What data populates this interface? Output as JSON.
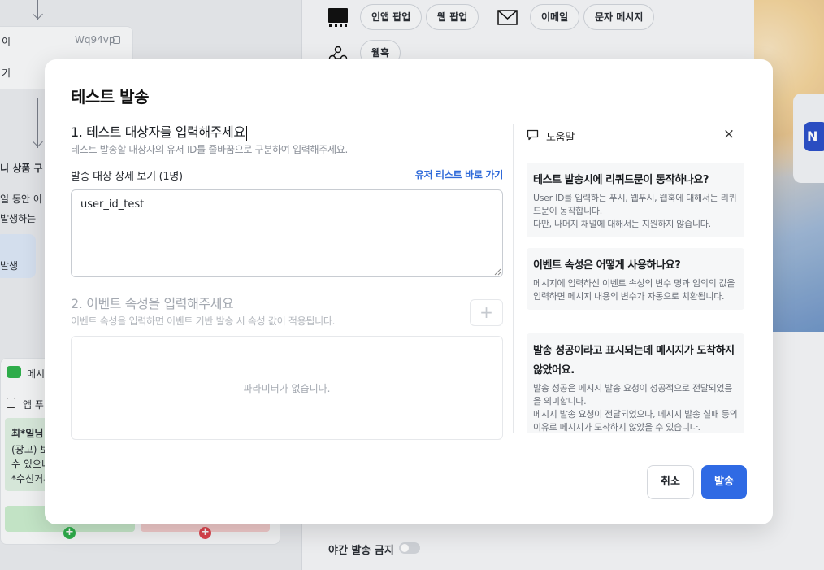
{
  "background": {
    "flow": {
      "node1_label": "이",
      "node1_code": "Wq94vp",
      "node1_sub": "기",
      "product_label": "니 상품 구",
      "period_text": "일 동안 이",
      "occur_text": "발생하는",
      "occur_badge": "발생",
      "message_node_label": "메시",
      "app_push_label": "앱 푸",
      "msg_preview_lines": [
        "최*일님",
        "(광고) 보",
        "수 있으니",
        "*수신거부"
      ]
    },
    "channels": {
      "in_app_popup": "인앱 팝업",
      "web_popup": "웹 팝업",
      "email": "이메일",
      "sms": "문자 메시지",
      "webhook": "웹훅"
    },
    "night_block_label": "야간 발송 금지"
  },
  "modal": {
    "title": "테스트 발송",
    "section1": {
      "title": "1. 테스트 대상자를 입력해주세요",
      "description": "테스트 발송할 대상자의 유저 ID를 줄바꿈으로 구분하여 입력해주세요.",
      "detail_label": "발송 대상 상세 보기 (1명)",
      "user_list_link": "유저 리스트 바로 가기",
      "targets_value": "user_id_test"
    },
    "section2": {
      "title": "2. 이벤트 속성을 입력해주세요",
      "description": "이벤트 속성을 입력하면 이벤트 기반 발송 시 속성 값이 적용됩니다.",
      "add_symbol": "+",
      "empty_text": "파라미터가 없습니다."
    },
    "help": {
      "title": "도움말",
      "close_symbol": "×",
      "items": [
        {
          "question": "테스트 발송시에 리퀴드문이 동작하나요?",
          "answer": "User ID를 입력하는 푸시, 웹푸시, 웹훅에 대해서는 리퀴드문이 동작합니다.\n다만, 나머지 채널에 대해서는 지원하지 않습니다."
        },
        {
          "question": "이벤트 속성은 어떻게 사용하나요?",
          "answer": "메시지에 입력하신 이벤트 속성의 변수 명과 임의의 값을 입력하면 메시지 내용의 변수가 자동으로 치환됩니다."
        },
        {
          "question": "발송 성공이라고 표시되는데 메시지가 도착하지 않았어요.",
          "answer": "발송 성공은 메시지 발송 요청이 성공적으로 전달되었음을 의미합니다.\n메시지 발송 요청이 전달되었으나, 메시지 발송 실패 등의 이유로 메시지가 도착하지 않았을 수 있습니다."
        }
      ]
    },
    "buttons": {
      "cancel": "취소",
      "send": "발송"
    }
  }
}
